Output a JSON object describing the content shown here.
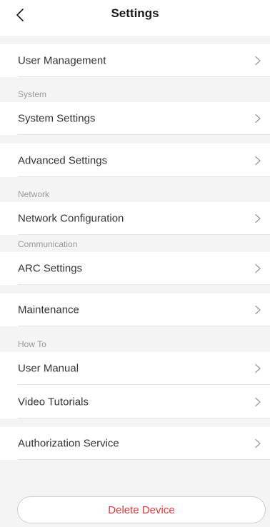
{
  "header": {
    "title": "Settings",
    "back_icon": "chevron-left-icon"
  },
  "sections": {
    "system": "System",
    "network": "Network",
    "communication": "Communication",
    "how_to": "How To"
  },
  "items": {
    "user_management": "User Management",
    "system_settings": "System Settings",
    "advanced_settings": "Advanced Settings",
    "network_configuration": "Network Configuration",
    "arc_settings": "ARC Settings",
    "maintenance": "Maintenance",
    "user_manual": "User Manual",
    "video_tutorials": "Video Tutorials",
    "authorization_service": "Authorization Service"
  },
  "actions": {
    "delete_device": "Delete Device"
  },
  "colors": {
    "background": "#f4f4f4",
    "row_background": "#ffffff",
    "section_label": "#9a9a9a",
    "danger": "#e2373a",
    "chevron": "#9a9a9a"
  }
}
